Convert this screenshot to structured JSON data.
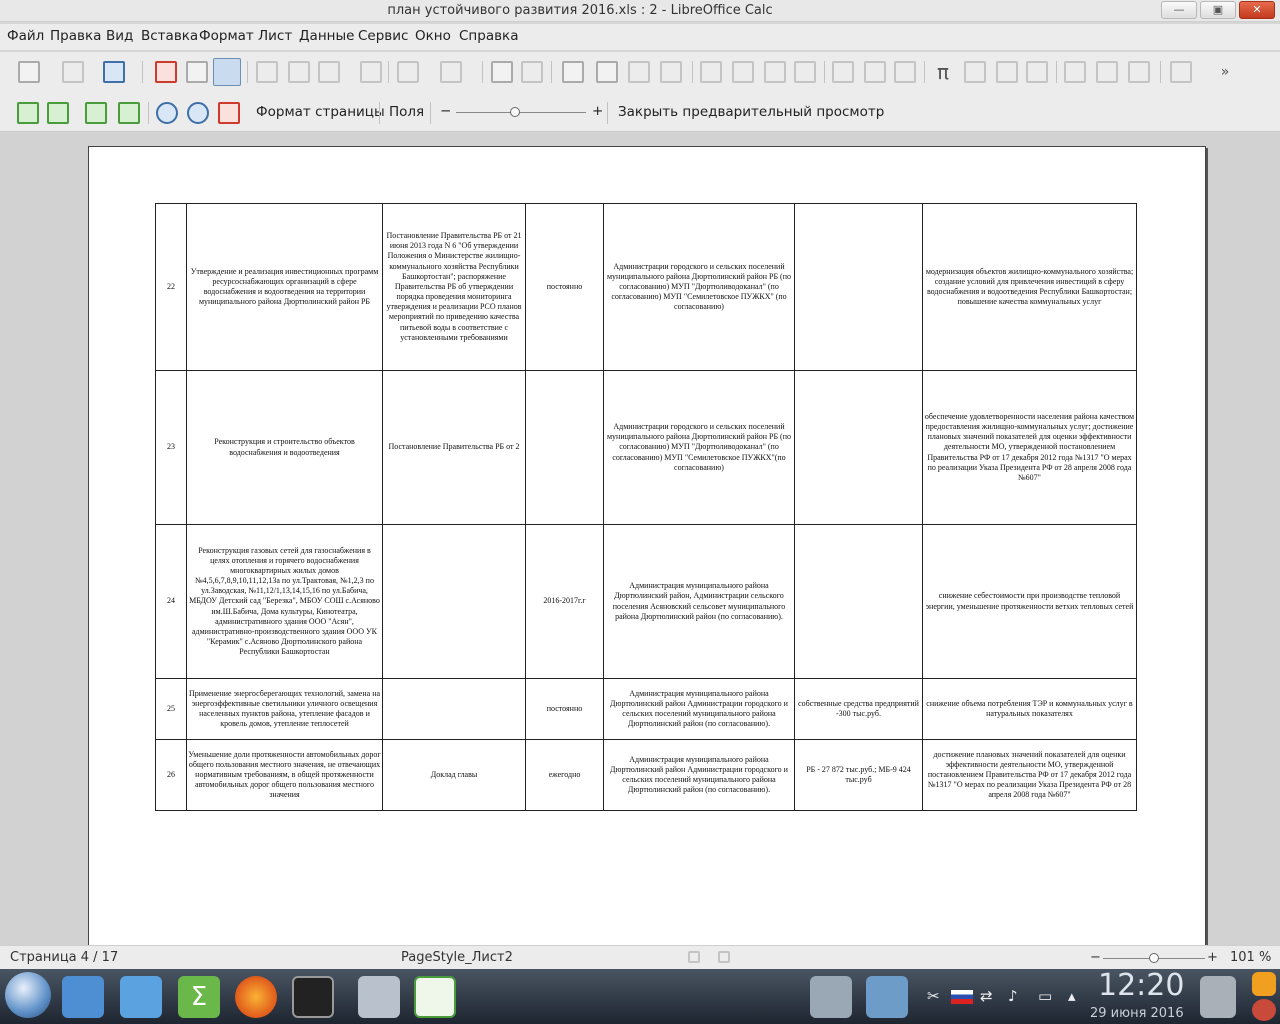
{
  "window": {
    "title": "план устойчивого развития 2016.xls : 2 - LibreOffice Calc",
    "buttons": [
      "—",
      "▣",
      "✕"
    ]
  },
  "menu": [
    "Файл",
    "Правка",
    "Вид",
    "Вставка",
    "Формат",
    "Лист",
    "Данные",
    "Сервис",
    "Окно",
    "Справка"
  ],
  "toolbar1_icons": [
    "new-icon",
    "templates-icon",
    "save-icon",
    "pdf-icon",
    "print-icon",
    "print-preview-icon",
    "cut-icon",
    "copy-icon",
    "paste-icon",
    "clone-format-icon",
    "undo-icon",
    "redo-icon",
    "find-icon",
    "spellcheck-icon",
    "row-icon",
    "column-icon",
    "insert-rows-icon",
    "insert-columns-icon",
    "sort-icon",
    "sort-asc-icon",
    "sort-desc-icon",
    "autofilter-icon",
    "image-icon",
    "chart-icon",
    "pivot-icon",
    "special-char-icon",
    "hyperlink-icon",
    "comment-icon",
    "headers-icon",
    "define-print-area-icon",
    "freeze-icon",
    "split-icon",
    "draw-icon",
    "more-icon"
  ],
  "preview_toolbar": {
    "page_format_label": "Формат страницы",
    "margins_label": "Поля",
    "zoom_minus": "−",
    "zoom_plus": "+",
    "zoom_fraction": 0.45,
    "close_preview_label": "Закрыть предварительный просмотр"
  },
  "table": {
    "rows": [
      {
        "num": "22",
        "name": "Утверждение и реализация инвестиционных программ ресурсоснабжающих организаций в сфере водоснабжения и водоотведения на территории муниципального района Дюртюлинский район РБ",
        "basis": "Постановление Правительства РБ от 21 июня 2013 года N 6 \"Об утверждении Положения о Министерстве жилищно-коммунального хозяйства Республики Башкортостан\"; распоряжение Правительства РБ об утверждении порядка проведения мониторинга утверждения и реализации РСО планов мероприятий по приведению качества питьевой воды в соответствие с установленными требованиями",
        "term": "постоянно",
        "executor": "Администрации городского и сельских поселений муниципального района Дюртюлинский район РБ (по согласованию) МУП \"Дюртюливодоканал\" (по согласованию) МУП \"Семилетовское ПУЖКХ\" (по согласованию)",
        "funding": "",
        "result": "модернизация объектов жилищно-коммунального хозяйства; создание условий для привлечения инвестиций в сферу водоснабжения и водоотведения Республики Башкортостан; повышение качества коммунальных услуг"
      },
      {
        "num": "23",
        "name": "Реконструкция и строительство объектов водоснабжения и водоотведения",
        "basis": "Постановление Правительства РБ от 2",
        "term": "",
        "executor": "Администрации городского и сельских поселений муниципального района Дюртюлинский район РБ (по согласованию) МУП \"Дюртюливодоканал\" (по согласованию) МУП \"Семилетовское ПУЖКХ\"(по согласованию)",
        "funding": "",
        "result": "обеспечение удовлетворенности населения района качеством предоставления жилищно-коммунальных услуг; достижение плановых значений показателей для оценки эффективности деятельности МО, утвержденной постановлением Правительства РФ от 17 декабря 2012 года №1317 \"О мерах по реализации Указа Президента РФ от 28 апреля 2008 года №607\""
      },
      {
        "num": "24",
        "name": "Реконструкция газовых сетей для газоснабжения в целях отопления и горячего водоснабжения многоквартирных жилых домов №4,5,6,7,8,9,10,11,12,13а по ул.Трактовая, №1,2,3 по ул.Заводская, №11,12/1,13,14,15,16 по ул.Бабича, МБДОУ Детский сад \"Березка\", МБОУ СОШ с.Асяново им.Ш.Бабича, Дома культуры, Кинотеатра, административного здания ООО \"Асян\", административно-производственного здания ООО УК \"Керамик\" с.Асяново Дюртюлинского района Республики Башкортостан",
        "basis": "",
        "term": "2016-2017г.г",
        "executor": "Администрация муниципального района Дюртюлинский район, Администрации сельского поселения Асяновский сельсовет муниципального района Дюртюлинский район (по согласованию).",
        "funding": "",
        "result": "снижение себестоимости при производстве тепловой энергии, уменьшение протяженности ветхих тепловых сетей"
      },
      {
        "num": "25",
        "name": "Применение энергосберегающих технологий, замена на энергоэффективные светильники уличного освещения населенных пунктов района, утепление фасадов и кровель домов, утепление теплосетей",
        "basis": "",
        "term": "постоянно",
        "executor": "Администрация муниципального района Дюртюлинский район Администрации городского и сельских поселений муниципального района Дюртюлинский район (по согласованию).",
        "funding": "собственные средства предприятий -300 тыс.руб.",
        "result": "снижение объема потребления ТЭР и коммунальных услуг в натуральных показателях"
      },
      {
        "num": "26",
        "name": "Уменьшение доли протяженности автомобильных дорог общего пользования местного значения, не отвечающих нормативным требованиям, в общей протяженности автомобильных дорог общего пользования местного значения",
        "basis": "Доклад главы",
        "term": "ежегодно",
        "executor": "Администрация муниципального района Дюртюлинский район Администрации городского и сельских поселений муниципального района Дюртюлинский район (по согласованию).",
        "funding": "РБ - 27 872 тыс.руб.; МБ-9 424 тыс.руб",
        "result": "достижение плановых значений показателей для оценки эффективности деятельности МО, утвержденной постановлением Правительства РФ от 17 декабря 2012 года №1317 \"О мерах по реализации Указа Президента РФ от 28 апреля 2008 года №607\""
      }
    ]
  },
  "status": {
    "page": "Страница 4 / 17",
    "style": "PageStyle_Лист2",
    "zoom_minus": "−",
    "zoom_plus": "+",
    "zoom": "101 %",
    "zoom_fraction": 0.5
  },
  "taskbar": {
    "apps": [
      "file-manager-icon",
      "text-editor-icon",
      "calc-sigma-icon",
      "firefox-icon",
      "terminal-icon",
      "screenshot-icon",
      "libreoffice-calc-icon"
    ],
    "clock": "12:20",
    "date": "29 июня 2016",
    "tray": [
      "scissors-icon",
      "ru-flag-icon",
      "network-icon",
      "volume-icon",
      "display-icon",
      "arrow-up-icon"
    ]
  },
  "colors": {
    "accent": "#3d6fa8",
    "taskbar": "#2a3440",
    "close": "#d84a2c"
  }
}
